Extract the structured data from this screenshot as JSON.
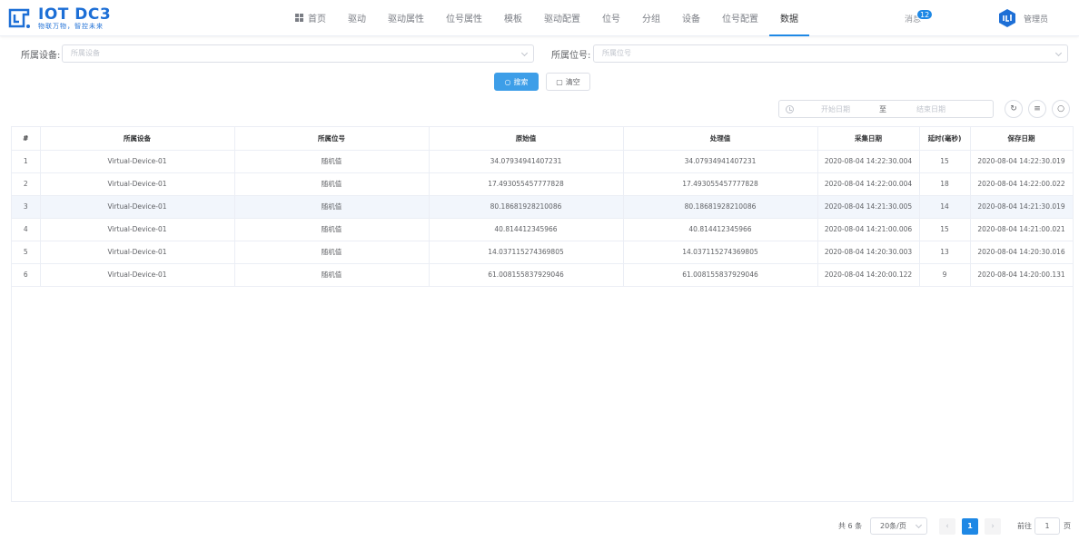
{
  "brand": {
    "title": "IOT DC3",
    "subtitle": "物联万物，智控未来",
    "color": "#1d6fd6"
  },
  "nav": [
    {
      "label": "首页",
      "icon": "grid-icon",
      "active": false
    },
    {
      "label": "驱动",
      "active": false
    },
    {
      "label": "驱动属性",
      "active": false
    },
    {
      "label": "位号属性",
      "active": false
    },
    {
      "label": "模板",
      "active": false
    },
    {
      "label": "驱动配置",
      "active": false
    },
    {
      "label": "位号",
      "active": false
    },
    {
      "label": "分组",
      "active": false
    },
    {
      "label": "设备",
      "active": false
    },
    {
      "label": "位号配置",
      "active": false
    },
    {
      "label": "数据",
      "active": true
    }
  ],
  "header": {
    "messages_label": "消息",
    "messages_count": "12",
    "user_name": "管理员"
  },
  "filters": {
    "device_label": "所属设备:",
    "device_placeholder": "所属设备",
    "point_label": "所属位号:",
    "point_placeholder": "所属位号"
  },
  "actions": {
    "search_label": "搜索",
    "clear_label": "清空"
  },
  "date_range": {
    "start_placeholder": "开始日期",
    "separator": "至",
    "end_placeholder": "结束日期"
  },
  "toolbar_icons": [
    "refresh-icon",
    "filter-icon",
    "search-icon"
  ],
  "table": {
    "columns": [
      "#",
      "所属设备",
      "所属位号",
      "原始值",
      "处理值",
      "采集日期",
      "延时(毫秒)",
      "保存日期"
    ],
    "rows": [
      [
        "1",
        "Virtual-Device-01",
        "随机值",
        "34.07934941407231",
        "34.07934941407231",
        "2020-08-04 14:22:30.004",
        "15",
        "2020-08-04 14:22:30.019"
      ],
      [
        "2",
        "Virtual-Device-01",
        "随机值",
        "17.493055457777828",
        "17.493055457777828",
        "2020-08-04 14:22:00.004",
        "18",
        "2020-08-04 14:22:00.022"
      ],
      [
        "3",
        "Virtual-Device-01",
        "随机值",
        "80.18681928210086",
        "80.18681928210086",
        "2020-08-04 14:21:30.005",
        "14",
        "2020-08-04 14:21:30.019"
      ],
      [
        "4",
        "Virtual-Device-01",
        "随机值",
        "40.814412345966",
        "40.814412345966",
        "2020-08-04 14:21:00.006",
        "15",
        "2020-08-04 14:21:00.021"
      ],
      [
        "5",
        "Virtual-Device-01",
        "随机值",
        "14.037115274369805",
        "14.037115274369805",
        "2020-08-04 14:20:30.003",
        "13",
        "2020-08-04 14:20:30.016"
      ],
      [
        "6",
        "Virtual-Device-01",
        "随机值",
        "61.008155837929046",
        "61.008155837929046",
        "2020-08-04 14:20:00.122",
        "9",
        "2020-08-04 14:20:00.131"
      ]
    ],
    "highlighted_row": 3
  },
  "pagination": {
    "total_label": "共 6 条",
    "page_size": "20条/页",
    "current_page": "1",
    "goto_label": "前往",
    "goto_value": "1",
    "page_suffix": "页"
  },
  "colors": {
    "accent": "#1e88e5",
    "button_primary": "#3d9ee8",
    "row_highlight": "#f2f6fc"
  }
}
